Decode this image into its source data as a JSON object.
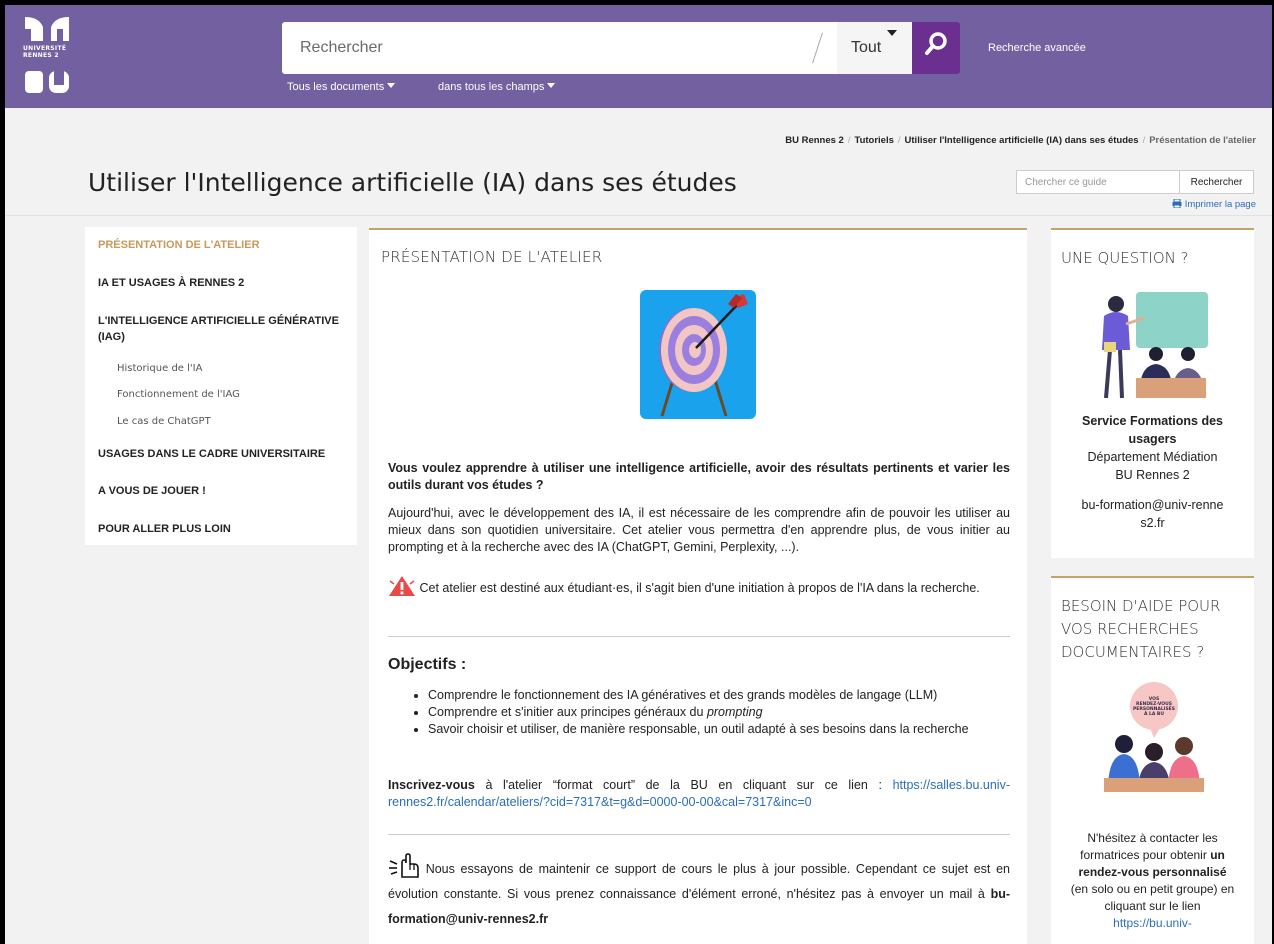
{
  "header": {
    "logo_text": "UNIVERSITÉ RENNES 2 BU",
    "search_placeholder": "Rechercher",
    "scope_label": "Tout",
    "advanced_search_label": "Recherche avancée",
    "filters": [
      "Tous les documents",
      "dans tous les champs"
    ],
    "brand_color": "#7360a0",
    "search_button_color": "#6b2f8f"
  },
  "breadcrumb": {
    "items": [
      "BU Rennes 2",
      "Tutoriels",
      "Utiliser l'Intelligence artificielle (IA) dans ses études"
    ],
    "current": "Présentation de l'atelier"
  },
  "page": {
    "title": "Utiliser l'Intelligence artificielle (IA) dans ses études",
    "guide_search_placeholder": "Chercher ce guide",
    "guide_search_button": "Rechercher",
    "print_label": "Imprimer la page"
  },
  "nav": {
    "items": [
      {
        "label": "PRÉSENTATION DE L'ATELIER",
        "active": true
      },
      {
        "label": "IA ET USAGES À RENNES 2"
      },
      {
        "label": "L'INTELLIGENCE ARTIFICIELLE GÉNÉRATIVE (IAG)"
      },
      {
        "label": "USAGES DANS LE CADRE UNIVERSITAIRE"
      },
      {
        "label": "A VOUS DE JOUER !"
      },
      {
        "label": "POUR ALLER PLUS LOIN"
      }
    ],
    "subitems": [
      "Historique de l'IA",
      "Fonctionnement de l'IAG",
      "Le cas de ChatGPT"
    ]
  },
  "main": {
    "title": "PRÉSENTATION DE L'ATELIER",
    "intro_question": "Vous voulez apprendre à utiliser une intelligence artificielle, avoir des résultats pertinents et varier les outils durant vos études ?",
    "paragraph": "Aujourd'hui, avec le développement des IA, il est nécessaire de les comprendre afin de pouvoir les utiliser au mieux dans son quotidien universitaire. Cet atelier vous permettra d'en apprendre plus, de vous initier au prompting et à la recherche avec des IA (ChatGPT, Gemini, Perplexity, ...).",
    "warning": "Cet atelier est destiné aux étudiant·es, il s'agit bien d'une initiation à propos de l'IA dans la recherche.",
    "objectives_title": "Objectifs :",
    "objectives": [
      "Comprendre le fonctionnement des IA génératives et des grands modèles de langage (LLM)",
      "Comprendre et s'initier aux principes généraux du",
      "Savoir choisir et utiliser, de manière responsable, un outil adapté à ses besoins dans la recherche"
    ],
    "objective_emphasis": "prompting",
    "signup_bold": "Inscrivez-vous",
    "signup_text": "à l'atelier “format court” de la BU en cliquant sur ce lien :",
    "signup_link": "https://salles.bu.univ-rennes2.fr/calendar/ateliers/?cid=7317&t=g&d=0000-00-00&cal=7317&inc=0",
    "update_text": "Nous essayons de maintenir ce support de cours le plus à jour possible. Cependant ce sujet est en évolution constante. Si vous prenez connaissance d'élément erroné, n'hésitez pas à envoyer un mail à",
    "update_email": "bu-formation@univ-rennes2.fr"
  },
  "sidebar": {
    "question": {
      "title": "UNE QUESTION ?",
      "service": "Service Formations des usagers",
      "department": "Département Médiation",
      "library": "BU Rennes 2",
      "email": "bu-formation@univ-rennes2.fr"
    },
    "help": {
      "title": "BESOIN D'AIDE POUR VOS RECHERCHES DOCUMENTAIRES ?",
      "bubble_text": "VOS RENDEZ-VOUS PERSONNALISÉS À LA BU",
      "text_before": "N'hésitez à contacter les formatrices pour obtenir",
      "text_bold": "un rendez-vous personnalisé",
      "text_after": "(en solo ou en petit groupe) en cliquant sur le lien",
      "link": "https://bu.univ-"
    }
  }
}
